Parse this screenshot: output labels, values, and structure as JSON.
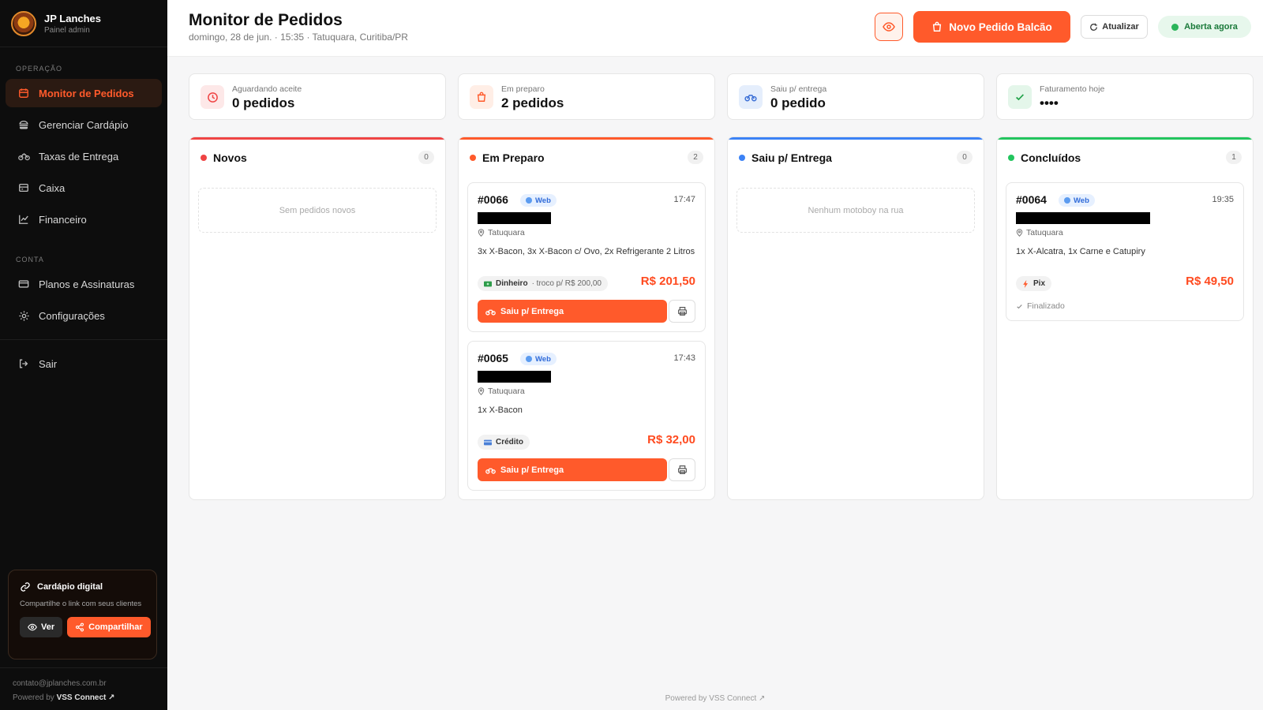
{
  "sidebar": {
    "brand": {
      "name": "JP Lanches",
      "subtitle": "Painel admin"
    },
    "section_operacao": "OPERAÇÃO",
    "section_conta": "CONTA",
    "items": [
      {
        "label": "Monitor de Pedidos",
        "icon": "calendar-icon",
        "active": true
      },
      {
        "label": "Gerenciar Cardápio",
        "icon": "burger-icon"
      },
      {
        "label": "Taxas de Entrega",
        "icon": "bike-icon"
      },
      {
        "label": "Caixa",
        "icon": "cash-register-icon"
      },
      {
        "label": "Financeiro",
        "icon": "chart-line-icon"
      }
    ],
    "account_items": [
      {
        "label": "Planos e Assinaturas",
        "icon": "card-icon"
      },
      {
        "label": "Configurações",
        "icon": "gear-icon"
      }
    ],
    "logout": {
      "label": "Sair",
      "icon": "logout-icon"
    },
    "promo": {
      "title": "Cardápio digital",
      "description": "Compartilhe o link com seus clientes",
      "view_label": "Ver",
      "share_label": "Compartilhar"
    },
    "footer": {
      "email": "contato@jplanches.com.br",
      "powered_prefix": "Powered by",
      "powered_brand": "VSS Connect ↗"
    }
  },
  "header": {
    "title": "Monitor de Pedidos",
    "subtitle": "domingo, 28 de jun. · 15:35 · Tatuquara, Curitiba/PR",
    "new_order_label": "Novo Pedido Balcão",
    "refresh_label": "Atualizar",
    "status_label": "Aberta agora"
  },
  "stats": [
    {
      "label": "Aguardando aceite",
      "value": "0 pedidos",
      "icon": "clock-icon"
    },
    {
      "label": "Em preparo",
      "value": "2 pedidos",
      "icon": "bag-icon"
    },
    {
      "label": "Saiu p/ entrega",
      "value": "0 pedido",
      "icon": "bike-icon"
    },
    {
      "label": "Faturamento hoje",
      "value": "••••",
      "icon": "check-icon"
    }
  ],
  "columns": {
    "novos": {
      "title": "Novos",
      "count": "0",
      "empty": "Sem pedidos novos"
    },
    "preparo": {
      "title": "Em Preparo",
      "count": "2"
    },
    "entrega": {
      "title": "Saiu p/ Entrega",
      "count": "0",
      "empty": "Nenhum motoboy na rua"
    },
    "concluidos": {
      "title": "Concluídos",
      "count": "1"
    }
  },
  "orders": {
    "o66": {
      "id": "#0066",
      "channel": "Web",
      "time": "17:47",
      "location": "Tatuquara",
      "items": "3x X-Bacon, 3x X-Bacon c/ Ovo, 2x Refrigerante 2 Litros",
      "payment_method": "Dinheiro",
      "payment_note": "· troco p/ R$ 200,00",
      "total": "R$ 201,50",
      "action_label": "Saiu p/ Entrega"
    },
    "o65": {
      "id": "#0065",
      "channel": "Web",
      "time": "17:43",
      "location": "Tatuquara",
      "items": "1x X-Bacon",
      "payment_method": "Crédito",
      "total": "R$ 32,00",
      "action_label": "Saiu p/ Entrega"
    },
    "o64": {
      "id": "#0064",
      "channel": "Web",
      "time": "19:35",
      "location": "Tatuquara",
      "items": "1x X-Alcatra, 1x Carne e Catupiry",
      "payment_method": "Pix",
      "total": "R$ 49,50",
      "status_label": "Finalizado"
    }
  },
  "footer": {
    "powered": "Powered by VSS Connect ↗"
  },
  "colors": {
    "accent": "#ff5a2b",
    "novos": "#ef4444",
    "preparo": "#ff5a2b",
    "entrega": "#3b82f6",
    "concluidos": "#22c55e"
  }
}
